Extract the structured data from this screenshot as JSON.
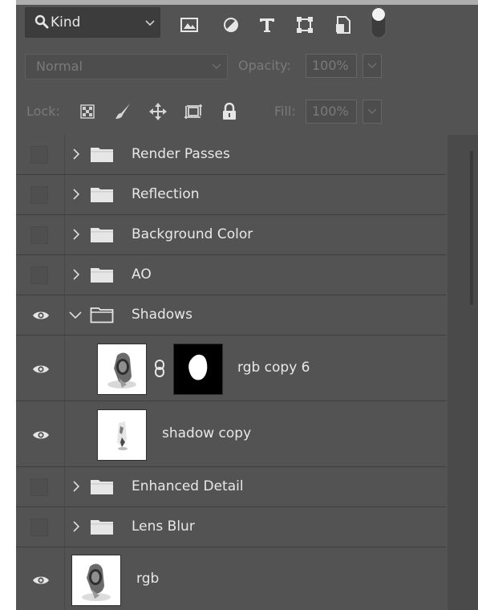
{
  "filter": {
    "kind_label": "Kind",
    "icons": [
      "image-filter-icon",
      "adjustment-filter-icon",
      "type-filter-icon",
      "shape-filter-icon",
      "smart-object-filter-icon",
      "filter-toggle-icon"
    ]
  },
  "blend": {
    "mode": "Normal",
    "opacity_label": "Opacity:",
    "opacity_value": "100%"
  },
  "lock": {
    "label": "Lock:",
    "fill_label": "Fill:",
    "fill_value": "100%",
    "icons": [
      "lock-transparent-pixels-icon",
      "lock-image-pixels-icon",
      "lock-position-icon",
      "lock-artboard-icon",
      "lock-all-icon"
    ]
  },
  "layers": [
    {
      "name": "Render Passes",
      "type": "group",
      "visible": false,
      "expanded": false
    },
    {
      "name": "Reflection",
      "type": "group",
      "visible": false,
      "expanded": false
    },
    {
      "name": "Background Color",
      "type": "group",
      "visible": false,
      "expanded": false
    },
    {
      "name": "AO",
      "type": "group",
      "visible": false,
      "expanded": false
    },
    {
      "name": "Shadows",
      "type": "group",
      "visible": true,
      "expanded": true
    },
    {
      "name": "rgb copy 6",
      "type": "layer",
      "visible": true,
      "has_mask": true
    },
    {
      "name": "shadow copy",
      "type": "layer",
      "visible": true,
      "has_mask": false
    },
    {
      "name": "Enhanced Detail",
      "type": "group",
      "visible": false,
      "expanded": false
    },
    {
      "name": "Lens Blur",
      "type": "group",
      "visible": false,
      "expanded": false
    },
    {
      "name": "rgb",
      "type": "layer",
      "visible": true,
      "has_mask": false
    }
  ],
  "colors": {
    "panel_bg": "#535353",
    "text": "#e8e8e8",
    "disabled_text": "#7a7a7a"
  }
}
